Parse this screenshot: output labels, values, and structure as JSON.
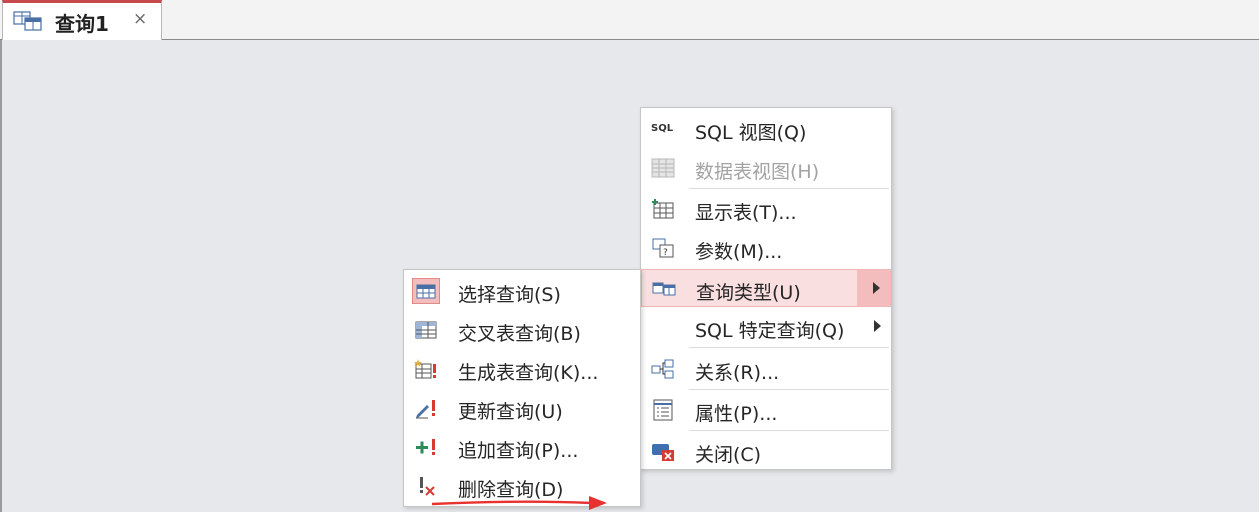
{
  "tab": {
    "title": "查询1",
    "close_glyph": "×",
    "icon": "query-design-icon"
  },
  "main_menu": {
    "items": [
      {
        "label": "SQL 视图(Q)",
        "accel": "Q",
        "icon": "sql-icon",
        "icon_text": "SQL",
        "disabled": false
      },
      {
        "label": "数据表视图(H)",
        "accel": "H",
        "icon": "datasheet-icon",
        "disabled": true
      },
      {
        "label": "显示表(T)...",
        "accel": "T",
        "icon": "show-table-icon",
        "disabled": false
      },
      {
        "label": "参数(M)...",
        "accel": "M",
        "icon": "parameters-icon",
        "disabled": false
      },
      {
        "label": "查询类型(U)",
        "accel": "U",
        "icon": "query-type-icon",
        "disabled": false,
        "submenu": true,
        "highlighted": true
      },
      {
        "label": "SQL 特定查询(Q)",
        "accel": "Q",
        "icon": "",
        "disabled": false,
        "submenu": true
      },
      {
        "label": "关系(R)...",
        "accel": "R",
        "icon": "relationships-icon",
        "disabled": false
      },
      {
        "label": "属性(P)...",
        "accel": "P",
        "icon": "properties-icon",
        "disabled": false
      },
      {
        "label": "关闭(C)",
        "accel": "C",
        "icon": "close-window-icon",
        "disabled": false
      }
    ]
  },
  "sub_menu": {
    "items": [
      {
        "label": "选择查询(S)",
        "accel": "S",
        "icon": "select-query-icon",
        "selected": true
      },
      {
        "label": "交叉表查询(B)",
        "accel": "B",
        "icon": "crosstab-query-icon"
      },
      {
        "label": "生成表查询(K)...",
        "accel": "K",
        "icon": "make-table-query-icon"
      },
      {
        "label": "更新查询(U)",
        "accel": "U",
        "icon": "update-query-icon"
      },
      {
        "label": "追加查询(P)...",
        "accel": "P",
        "icon": "append-query-icon"
      },
      {
        "label": "删除查询(D)",
        "accel": "D",
        "icon": "delete-query-icon"
      }
    ]
  },
  "colors": {
    "accent": "#c7494c",
    "highlight_bg": "#f9dfdf",
    "annotation_arrow": "#e8322f",
    "canvas_bg": "#e6e8eb"
  }
}
